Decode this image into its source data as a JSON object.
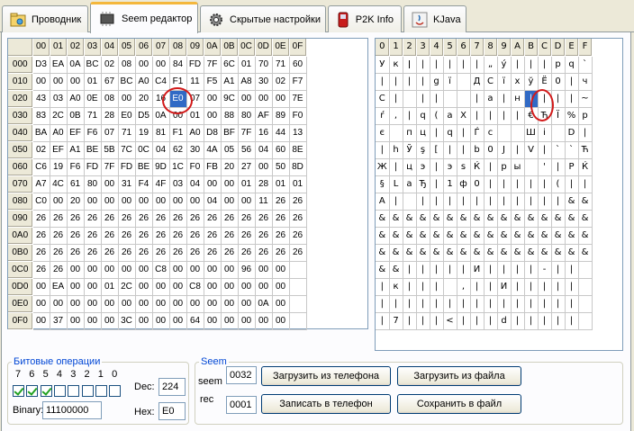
{
  "tabs": [
    {
      "label": "Проводник",
      "icon": "explorer-icon"
    },
    {
      "label": "Seem редактор",
      "icon": "chip-icon"
    },
    {
      "label": "Скрытые настройки",
      "icon": "gear-icon"
    },
    {
      "label": "P2K Info",
      "icon": "phone-icon"
    },
    {
      "label": "KJava",
      "icon": "java-icon"
    }
  ],
  "hex_grid": {
    "columns": [
      "00",
      "01",
      "02",
      "03",
      "04",
      "05",
      "06",
      "07",
      "08",
      "09",
      "0A",
      "0B",
      "0C",
      "0D",
      "0E",
      "0F"
    ],
    "rows": [
      {
        "offset": "000",
        "cells": [
          "D3",
          "EA",
          "0A",
          "BC",
          "02",
          "08",
          "00",
          "00",
          "84",
          "FD",
          "7F",
          "6C",
          "01",
          "70",
          "71",
          "60"
        ]
      },
      {
        "offset": "010",
        "cells": [
          "00",
          "00",
          "00",
          "01",
          "67",
          "BC",
          "A0",
          "C4",
          "F1",
          "11",
          "F5",
          "A1",
          "A8",
          "30",
          "02",
          "F7"
        ]
      },
      {
        "offset": "020",
        "cells": [
          "43",
          "03",
          "A0",
          "0E",
          "08",
          "00",
          "20",
          "16",
          "E0",
          "07",
          "00",
          "9C",
          "00",
          "00",
          "00",
          "7E"
        ]
      },
      {
        "offset": "030",
        "cells": [
          "83",
          "2C",
          "0B",
          "71",
          "28",
          "E0",
          "D5",
          "0A",
          "00",
          "01",
          "00",
          "88",
          "80",
          "AF",
          "89",
          "F0"
        ]
      },
      {
        "offset": "040",
        "cells": [
          "BA",
          "A0",
          "EF",
          "F6",
          "07",
          "71",
          "19",
          "81",
          "F1",
          "A0",
          "D8",
          "BF",
          "7F",
          "16",
          "44",
          "13"
        ]
      },
      {
        "offset": "050",
        "cells": [
          "02",
          "EF",
          "A1",
          "BE",
          "5B",
          "7C",
          "0C",
          "04",
          "62",
          "30",
          "4A",
          "05",
          "56",
          "04",
          "60",
          "8E"
        ]
      },
      {
        "offset": "060",
        "cells": [
          "C6",
          "19",
          "F6",
          "FD",
          "7F",
          "FD",
          "BE",
          "9D",
          "1C",
          "F0",
          "FB",
          "20",
          "27",
          "00",
          "50",
          "8D"
        ]
      },
      {
        "offset": "070",
        "cells": [
          "A7",
          "4C",
          "61",
          "80",
          "00",
          "31",
          "F4",
          "4F",
          "03",
          "04",
          "00",
          "00",
          "01",
          "28",
          "01",
          "01"
        ]
      },
      {
        "offset": "080",
        "cells": [
          "C0",
          "00",
          "20",
          "00",
          "00",
          "00",
          "00",
          "00",
          "00",
          "00",
          "04",
          "00",
          "00",
          "11",
          "26",
          "26"
        ]
      },
      {
        "offset": "090",
        "cells": [
          "26",
          "26",
          "26",
          "26",
          "26",
          "26",
          "26",
          "26",
          "26",
          "26",
          "26",
          "26",
          "26",
          "26",
          "26",
          "26"
        ]
      },
      {
        "offset": "0A0",
        "cells": [
          "26",
          "26",
          "26",
          "26",
          "26",
          "26",
          "26",
          "26",
          "26",
          "26",
          "26",
          "26",
          "26",
          "26",
          "26",
          "26"
        ]
      },
      {
        "offset": "0B0",
        "cells": [
          "26",
          "26",
          "26",
          "26",
          "26",
          "26",
          "26",
          "26",
          "26",
          "26",
          "26",
          "26",
          "26",
          "26",
          "26",
          "26"
        ]
      },
      {
        "offset": "0C0",
        "cells": [
          "26",
          "26",
          "00",
          "00",
          "00",
          "00",
          "00",
          "C8",
          "00",
          "00",
          "00",
          "00",
          "96",
          "00",
          "00",
          ""
        ]
      },
      {
        "offset": "0D0",
        "cells": [
          "00",
          "EA",
          "00",
          "00",
          "01",
          "2C",
          "00",
          "00",
          "00",
          "C8",
          "00",
          "00",
          "00",
          "00",
          "00",
          ""
        ]
      },
      {
        "offset": "0E0",
        "cells": [
          "00",
          "00",
          "00",
          "00",
          "00",
          "00",
          "00",
          "00",
          "00",
          "00",
          "00",
          "00",
          "00",
          "0A",
          "00",
          ""
        ]
      },
      {
        "offset": "0F0",
        "cells": [
          "00",
          "37",
          "00",
          "00",
          "00",
          "3C",
          "00",
          "00",
          "00",
          "64",
          "00",
          "00",
          "00",
          "00",
          "00",
          ""
        ]
      }
    ]
  },
  "char_grid": {
    "columns": [
      "0",
      "1",
      "2",
      "3",
      "4",
      "5",
      "6",
      "7",
      "8",
      "9",
      "A",
      "B",
      "C",
      "D",
      "E",
      "F"
    ],
    "rows": [
      [
        "У",
        "к",
        "ǀ",
        "|",
        "|",
        "|",
        "|",
        "|",
        "„",
        "ý",
        "|",
        "|",
        "|",
        "р",
        "q",
        "`"
      ],
      [
        "|",
        "|",
        "|",
        "|",
        "g",
        "ї",
        "",
        "Д",
        "С",
        "ї",
        "х",
        "ў",
        "Ё",
        "0",
        "|",
        "ч"
      ],
      [
        "С",
        "|",
        "",
        "|",
        "|",
        "",
        "",
        "|",
        "a",
        "|",
        "н",
        "|",
        "|",
        "|",
        "|",
        "~"
      ],
      [
        "ŕ",
        ",",
        "|",
        "q",
        "(",
        "a",
        "Х",
        "|",
        "|",
        "|",
        "|",
        "€",
        "Ђ",
        "Ї",
        "%",
        "р"
      ],
      [
        "є",
        "",
        "п",
        "ц",
        "|",
        "q",
        "|",
        "Ѓ",
        "с",
        "",
        "",
        "Ш",
        "і",
        "",
        "D",
        "|"
      ],
      [
        "|",
        "h",
        "Ў",
        "ş",
        "[",
        "|",
        "|",
        "b",
        "0",
        "J",
        "|",
        "V",
        "|",
        "`",
        "`",
        "Ћ"
      ],
      [
        "Ж",
        "|",
        "ц",
        "э",
        "|",
        "э",
        "ѕ",
        "Ќ",
        "|",
        "р",
        "ы",
        "",
        "'",
        "|",
        "Р",
        "Ќ"
      ],
      [
        "§",
        "L",
        "a",
        "Ђ",
        "|",
        "1",
        "ф",
        "0",
        "|",
        "|",
        "|",
        "|",
        "|",
        "(",
        "|",
        "|"
      ],
      [
        "А",
        "|",
        "",
        "|",
        "|",
        "|",
        "|",
        "|",
        "|",
        "|",
        "|",
        "|",
        "|",
        "|",
        "&",
        "&"
      ],
      [
        "&",
        "&",
        "&",
        "&",
        "&",
        "&",
        "&",
        "&",
        "&",
        "&",
        "&",
        "&",
        "&",
        "&",
        "&",
        "&"
      ],
      [
        "&",
        "&",
        "&",
        "&",
        "&",
        "&",
        "&",
        "&",
        "&",
        "&",
        "&",
        "&",
        "&",
        "&",
        "&",
        "&"
      ],
      [
        "&",
        "&",
        "&",
        "&",
        "&",
        "&",
        "&",
        "&",
        "&",
        "&",
        "&",
        "&",
        "&",
        "&",
        "&",
        "&"
      ],
      [
        "&",
        "&",
        "|",
        "|",
        "|",
        "|",
        "|",
        "И",
        "|",
        "|",
        "|",
        "|",
        "-",
        "|",
        "|",
        ""
      ],
      [
        "|",
        "к",
        "|",
        "|",
        "|",
        "",
        ",",
        "|",
        "|",
        "И",
        "|",
        "|",
        "|",
        "|",
        "|",
        ""
      ],
      [
        "|",
        "|",
        "|",
        "|",
        "|",
        "|",
        "|",
        "|",
        "|",
        "|",
        "|",
        "|",
        "|",
        "|",
        "|",
        ""
      ],
      [
        "|",
        "7",
        "|",
        "|",
        "|",
        "<",
        "|",
        "|",
        "|",
        "d",
        "|",
        "|",
        "|",
        "|",
        "|",
        ""
      ]
    ]
  },
  "selected": {
    "row": 2,
    "col": 8
  },
  "bit_ops": {
    "legend": "Битовые операции",
    "bit_labels": [
      "7",
      "6",
      "5",
      "4",
      "3",
      "2",
      "1",
      "0"
    ],
    "bits": [
      true,
      true,
      true,
      false,
      false,
      false,
      false,
      false
    ],
    "binary_label": "Binary:",
    "binary_value": "11100000",
    "dec_label": "Dec:",
    "dec_value": "224",
    "hex_label": "Hex:",
    "hex_value": "E0"
  },
  "seem": {
    "legend": "Seem",
    "seem_label": "seem",
    "seem_value": "0032",
    "rec_label": "rec",
    "rec_value": "0001",
    "load_phone": "Загрузить из телефона",
    "load_file": "Загрузить из файла",
    "write_phone": "Записать в телефон",
    "save_file": "Сохранить в файл"
  },
  "colors": {
    "selection": "#316ac5",
    "highlight_circle": "#d21a1a",
    "group_legend": "#0046d5"
  }
}
